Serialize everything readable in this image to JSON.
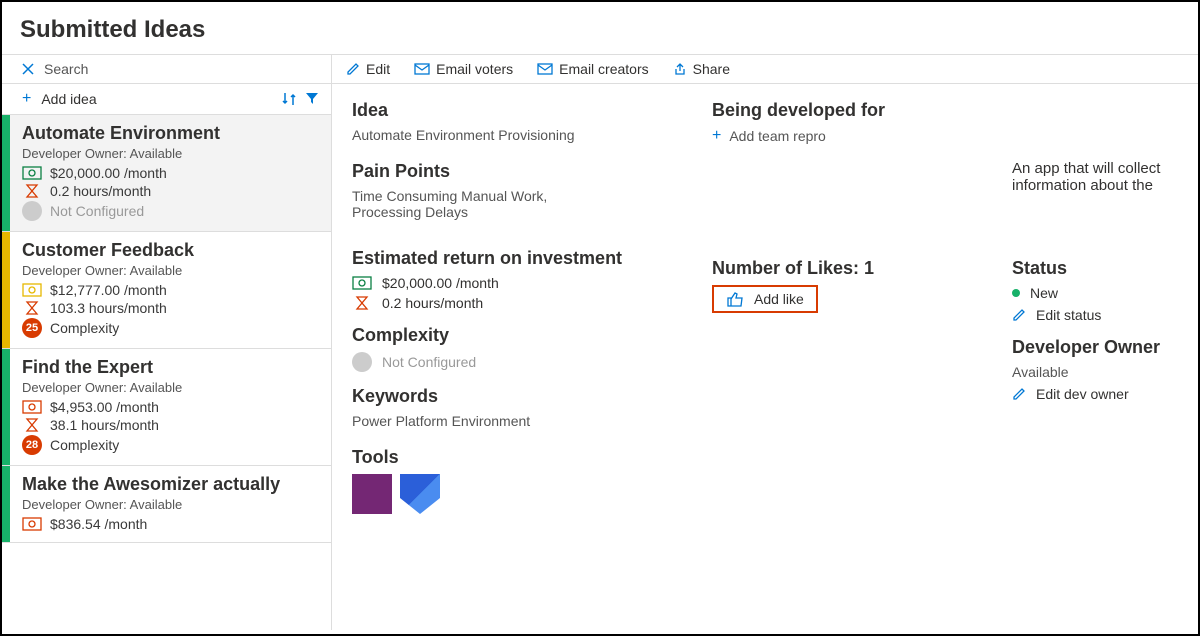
{
  "page_title": "Submitted Ideas",
  "search_placeholder": "Search",
  "add_idea_label": "Add idea",
  "toolbar": {
    "edit": "Edit",
    "email_voters": "Email voters",
    "email_creators": "Email creators",
    "share": "Share"
  },
  "ideas": [
    {
      "title": "Automate Environment",
      "owner": "Developer Owner: Available",
      "cost": "$20,000.00 /month",
      "hours": "0.2 hours/month",
      "complexity": "Not Configured",
      "complexity_badge": "",
      "color": "#17b169",
      "bill_color_class": "icon-bill",
      "badge_class": "grey",
      "selected": true
    },
    {
      "title": "Customer Feedback",
      "owner": "Developer Owner: Available",
      "cost": "$12,777.00 /month",
      "hours": "103.3 hours/month",
      "complexity": "Complexity",
      "complexity_badge": "25",
      "color": "#e6b800",
      "bill_color_class": "icon-bill-yellow",
      "badge_class": "",
      "selected": false
    },
    {
      "title": "Find the Expert",
      "owner": "Developer Owner: Available",
      "cost": "$4,953.00 /month",
      "hours": "38.1 hours/month",
      "complexity": "Complexity",
      "complexity_badge": "28",
      "color": "#17b169",
      "bill_color_class": "icon-bill-red",
      "badge_class": "",
      "selected": false
    },
    {
      "title": "Make the Awesomizer actually",
      "owner": "Developer Owner: Available",
      "cost": "$836.54 /month",
      "hours": "",
      "complexity": "",
      "complexity_badge": "",
      "color": "#17b169",
      "bill_color_class": "icon-bill-red",
      "badge_class": "",
      "selected": false
    }
  ],
  "detail": {
    "idea_label": "Idea",
    "idea_value": "Automate Environment Provisioning",
    "pain_label": "Pain Points",
    "pain_value": "Time Consuming Manual Work, Processing Delays",
    "roi_label": "Estimated return on investment",
    "roi_cost": "$20,000.00 /month",
    "roi_hours": "0.2 hours/month",
    "complexity_label": "Complexity",
    "complexity_value": "Not Configured",
    "keywords_label": "Keywords",
    "keywords_value": "Power Platform Environment",
    "tools_label": "Tools",
    "developed_label": "Being developed for",
    "add_team_repro": "Add team repro",
    "likes_label": "Number of Likes: 1",
    "add_like": "Add like",
    "status_label": "Status",
    "status_value": "New",
    "edit_status": "Edit status",
    "dev_owner_label": "Developer Owner",
    "dev_owner_value": "Available",
    "edit_dev_owner": "Edit dev owner",
    "description": "An app that will collect information about the"
  }
}
